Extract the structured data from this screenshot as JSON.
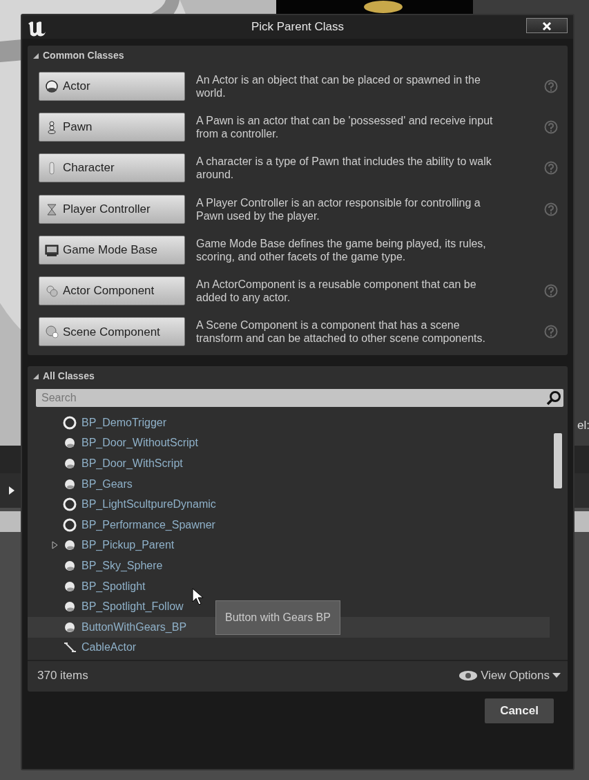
{
  "window": {
    "title": "Pick Parent Class"
  },
  "background": {
    "side_text": "el:"
  },
  "common_classes": {
    "header": "Common Classes",
    "items": [
      {
        "kind": "actor",
        "label": "Actor",
        "description": "An Actor is an object that can be placed or spawned in the world.",
        "help": true
      },
      {
        "kind": "pawn",
        "label": "Pawn",
        "description": "A Pawn is an actor that can be 'possessed' and receive input from a controller.",
        "help": true
      },
      {
        "kind": "character",
        "label": "Character",
        "description": "A character is a type of Pawn that includes the ability to walk around.",
        "help": true
      },
      {
        "kind": "controller",
        "label": "Player Controller",
        "description": "A Player Controller is an actor responsible for controlling a Pawn used by the player.",
        "help": true
      },
      {
        "kind": "gamemode",
        "label": "Game Mode Base",
        "description": "Game Mode Base defines the game being played, its rules, scoring, and other facets of the game type.",
        "help": false
      },
      {
        "kind": "actor_component",
        "label": "Actor Component",
        "description": "An ActorComponent is a reusable component that can be added to any actor.",
        "help": true
      },
      {
        "kind": "scene_component",
        "label": "Scene Component",
        "description": "A Scene Component is a component that has a scene transform and can be attached to other scene components.",
        "help": true
      }
    ]
  },
  "all_classes": {
    "header": "All Classes",
    "search": {
      "placeholder": "Search"
    },
    "items": [
      {
        "kind": "ring",
        "label": "BP_DemoTrigger",
        "expandable": false,
        "hovered": false
      },
      {
        "kind": "ball",
        "label": "BP_Door_WithoutScript",
        "expandable": false,
        "hovered": false
      },
      {
        "kind": "ball",
        "label": "BP_Door_WithScript",
        "expandable": false,
        "hovered": false
      },
      {
        "kind": "ball",
        "label": "BP_Gears",
        "expandable": false,
        "hovered": false
      },
      {
        "kind": "ring",
        "label": "BP_LightScultpureDynamic",
        "expandable": false,
        "hovered": false
      },
      {
        "kind": "ring",
        "label": "BP_Performance_Spawner",
        "expandable": false,
        "hovered": false
      },
      {
        "kind": "ball",
        "label": "BP_Pickup_Parent",
        "expandable": true,
        "hovered": false
      },
      {
        "kind": "ball",
        "label": "BP_Sky_Sphere",
        "expandable": false,
        "hovered": false
      },
      {
        "kind": "ball",
        "label": "BP_Spotlight",
        "expandable": false,
        "hovered": false
      },
      {
        "kind": "ball",
        "label": "BP_Spotlight_Follow",
        "expandable": false,
        "hovered": false
      },
      {
        "kind": "ball",
        "label": "ButtonWithGears_BP",
        "expandable": false,
        "hovered": true
      },
      {
        "kind": "cable",
        "label": "CableActor",
        "expandable": false,
        "hovered": false
      }
    ],
    "tooltip": "Button with Gears BP",
    "count": "370 items",
    "view_options": "View Options"
  },
  "buttons": [
    "Cancel"
  ]
}
